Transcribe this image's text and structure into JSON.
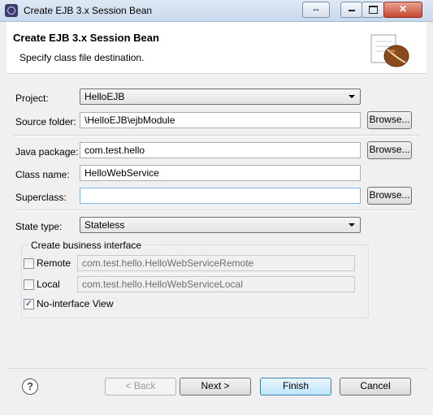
{
  "window": {
    "title": "Create EJB 3.x Session Bean",
    "controls": {
      "restore_icon": "⇔",
      "close_icon": "✕"
    }
  },
  "header": {
    "title": "Create EJB 3.x Session Bean",
    "subtitle": "Specify class file destination."
  },
  "form": {
    "project_label": "Project:",
    "project_value": "HelloEJB",
    "source_folder_label": "Source folder:",
    "source_folder_value": "\\HelloEJB\\ejbModule",
    "java_package_label": "Java package:",
    "java_package_value": "com.test.hello",
    "class_name_label": "Class name:",
    "class_name_value": "HelloWebService",
    "superclass_label": "Superclass:",
    "superclass_value": "",
    "browse_label": "Browse...",
    "state_type_label": "State type:",
    "state_type_value": "Stateless"
  },
  "business_interface": {
    "group_title": "Create business interface",
    "remote_label": "Remote",
    "remote_checked": false,
    "remote_value": "com.test.hello.HelloWebServiceRemote",
    "local_label": "Local",
    "local_checked": false,
    "local_value": "com.test.hello.HelloWebServiceLocal",
    "no_interface_label": "No-interface View",
    "no_interface_checked": true
  },
  "buttons": {
    "help": "?",
    "back": "< Back",
    "next": "Next >",
    "finish": "Finish",
    "cancel": "Cancel"
  }
}
